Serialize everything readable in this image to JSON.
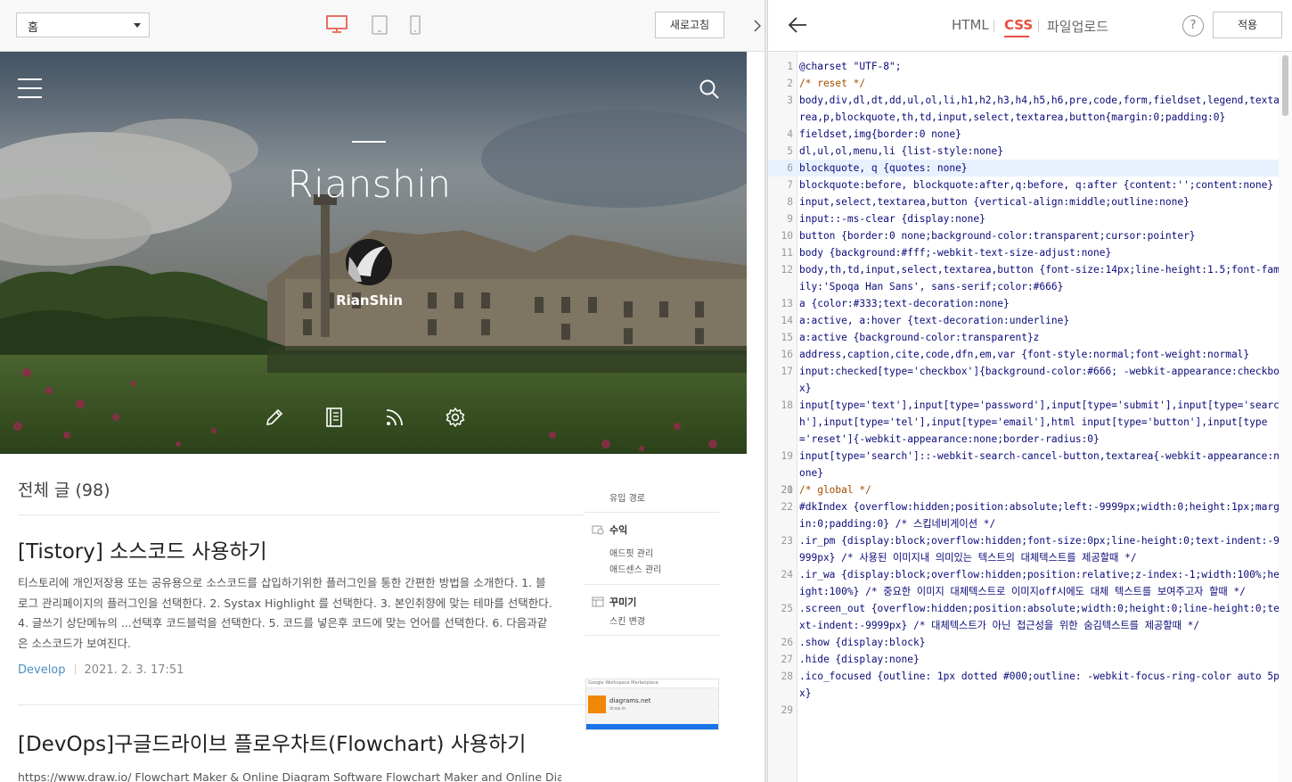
{
  "preview_toolbar": {
    "page_select_value": "홈",
    "refresh_label": "새로고침",
    "accent_color": "#e84e40"
  },
  "blog": {
    "title": "Rianshin",
    "author": "RianShin",
    "all_posts_label": "전체 글 (98)"
  },
  "posts": [
    {
      "title": "[Tistory] 소스코드 사용하기",
      "excerpt": "티스토리에 개인저장용 또는 공유용으로 소스코드를 삽입하기위한 플러그인을 통한 간편한 방법을 소개한다. 1. 블로그 관리페이지의 플러그인을 선택한다. 2. Systax Highlight 를 선택한다. 3. 본인취향에 맞는 테마를 선택한다. 4. 글쓰기 상단메뉴의 ...선택후 코드블럭을 선택한다. 5. 코드를 넣은후 코드에 맞는 언어를 선택한다. 6. 다음과같은 소스코드가 보여진다.",
      "category": "Develop",
      "date": "2021. 2. 3. 17:51"
    },
    {
      "title": "[DevOps]구글드라이브 플로우차트(Flowchart) 사용하기",
      "excerpt": "https://www.draw.io/ Flowchart Maker & Online Diagram Software Flowchart Maker and Online Dia"
    }
  ],
  "admin_menu": {
    "visit_path": "유입 경로",
    "revenue": "수익",
    "adfit": "애드핏 관리",
    "adsense": "애드센스 관리",
    "decorate": "꾸미기",
    "skin_change": "스킨 변경"
  },
  "thumbnail": {
    "header": "Google Workspace Marketplace",
    "app_name": "diagrams.net",
    "app_sub": "draw.io"
  },
  "editor": {
    "tabs": [
      "HTML",
      "CSS",
      "파일업로드"
    ],
    "active_tab": "CSS",
    "help_label": "?",
    "apply_label": "적용",
    "lines": [
      {
        "n": "1",
        "t": "@charset \"UTF-8\";"
      },
      {
        "n": "2",
        "t": "/* reset */"
      },
      {
        "n": "3",
        "t": "body,div,dl,dt,dd,ul,ol,li,h1,h2,h3,h4,h5,h6,pre,code,form,fieldset,legend,textarea,p,blockquote,th,td,input,select,textarea,button{margin:0;padding:0}"
      },
      {
        "n": "4",
        "t": "fieldset,img{border:0 none}"
      },
      {
        "n": "5",
        "t": "dl,ul,ol,menu,li {list-style:none}"
      },
      {
        "n": "6",
        "t": "blockquote, q {quotes: none}"
      },
      {
        "n": "7",
        "t": "blockquote:before, blockquote:after,q:before, q:after {content:'';content:none}"
      },
      {
        "n": "8",
        "t": "input,select,textarea,button {vertical-align:middle;outline:none}"
      },
      {
        "n": "9",
        "t": "input::-ms-clear {display:none}"
      },
      {
        "n": "10",
        "t": "button {border:0 none;background-color:transparent;cursor:pointer}"
      },
      {
        "n": "11",
        "t": "body {background:#fff;-webkit-text-size-adjust:none}"
      },
      {
        "n": "12",
        "t": "body,th,td,input,select,textarea,button {font-size:14px;line-height:1.5;font-family:'Spoqa Han Sans', sans-serif;color:#666}"
      },
      {
        "n": "13",
        "t": "a {color:#333;text-decoration:none}"
      },
      {
        "n": "14",
        "t": "a:active, a:hover {text-decoration:underline}"
      },
      {
        "n": "15",
        "t": "a:active {background-color:transparent}z"
      },
      {
        "n": "16",
        "t": "address,caption,cite,code,dfn,em,var {font-style:normal;font-weight:normal}"
      },
      {
        "n": "17",
        "t": "input:checked[type='checkbox']{background-color:#666; -webkit-appearance:checkbox}"
      },
      {
        "n": "18",
        "t": "input[type='text'],input[type='password'],input[type='submit'],input[type='search'],input[type='tel'],input[type='email'],html input[type='button'],input[type='reset']{-webkit-appearance:none;border-radius:0}"
      },
      {
        "n": "19",
        "t": "input[type='search']::-webkit-search-cancel-button,textarea{-webkit-appearance:none}"
      },
      {
        "n": "20",
        "t": ""
      },
      {
        "n": "21",
        "t": "/* global */"
      },
      {
        "n": "22",
        "t": "#dkIndex {overflow:hidden;position:absolute;left:-9999px;width:0;height:1px;margin:0;padding:0} /* 스킵네비게이션 */"
      },
      {
        "n": "23",
        "t": ".ir_pm {display:block;overflow:hidden;font-size:0px;line-height:0;text-indent:-9999px} /* 사용된 이미지내 의미있는 텍스트의 대체텍스트를 제공할때 */"
      },
      {
        "n": "24",
        "t": ".ir_wa {display:block;overflow:hidden;position:relative;z-index:-1;width:100%;height:100%} /* 중요한 이미지 대체텍스트로 이미지off시에도 대체 텍스트를 보여주고자 할때 */"
      },
      {
        "n": "25",
        "t": ".screen_out {overflow:hidden;position:absolute;width:0;height:0;line-height:0;text-indent:-9999px} /* 대체텍스트가 아닌 접근성을 위한 숨김텍스트를 제공할때 */"
      },
      {
        "n": "26",
        "t": ".show {display:block}"
      },
      {
        "n": "27",
        "t": ".hide {display:none}"
      },
      {
        "n": "28",
        "t": ".ico_focused {outline: 1px dotted #000;outline: -webkit-focus-ring-color auto 5px}"
      },
      {
        "n": "29",
        "t": ""
      }
    ]
  }
}
